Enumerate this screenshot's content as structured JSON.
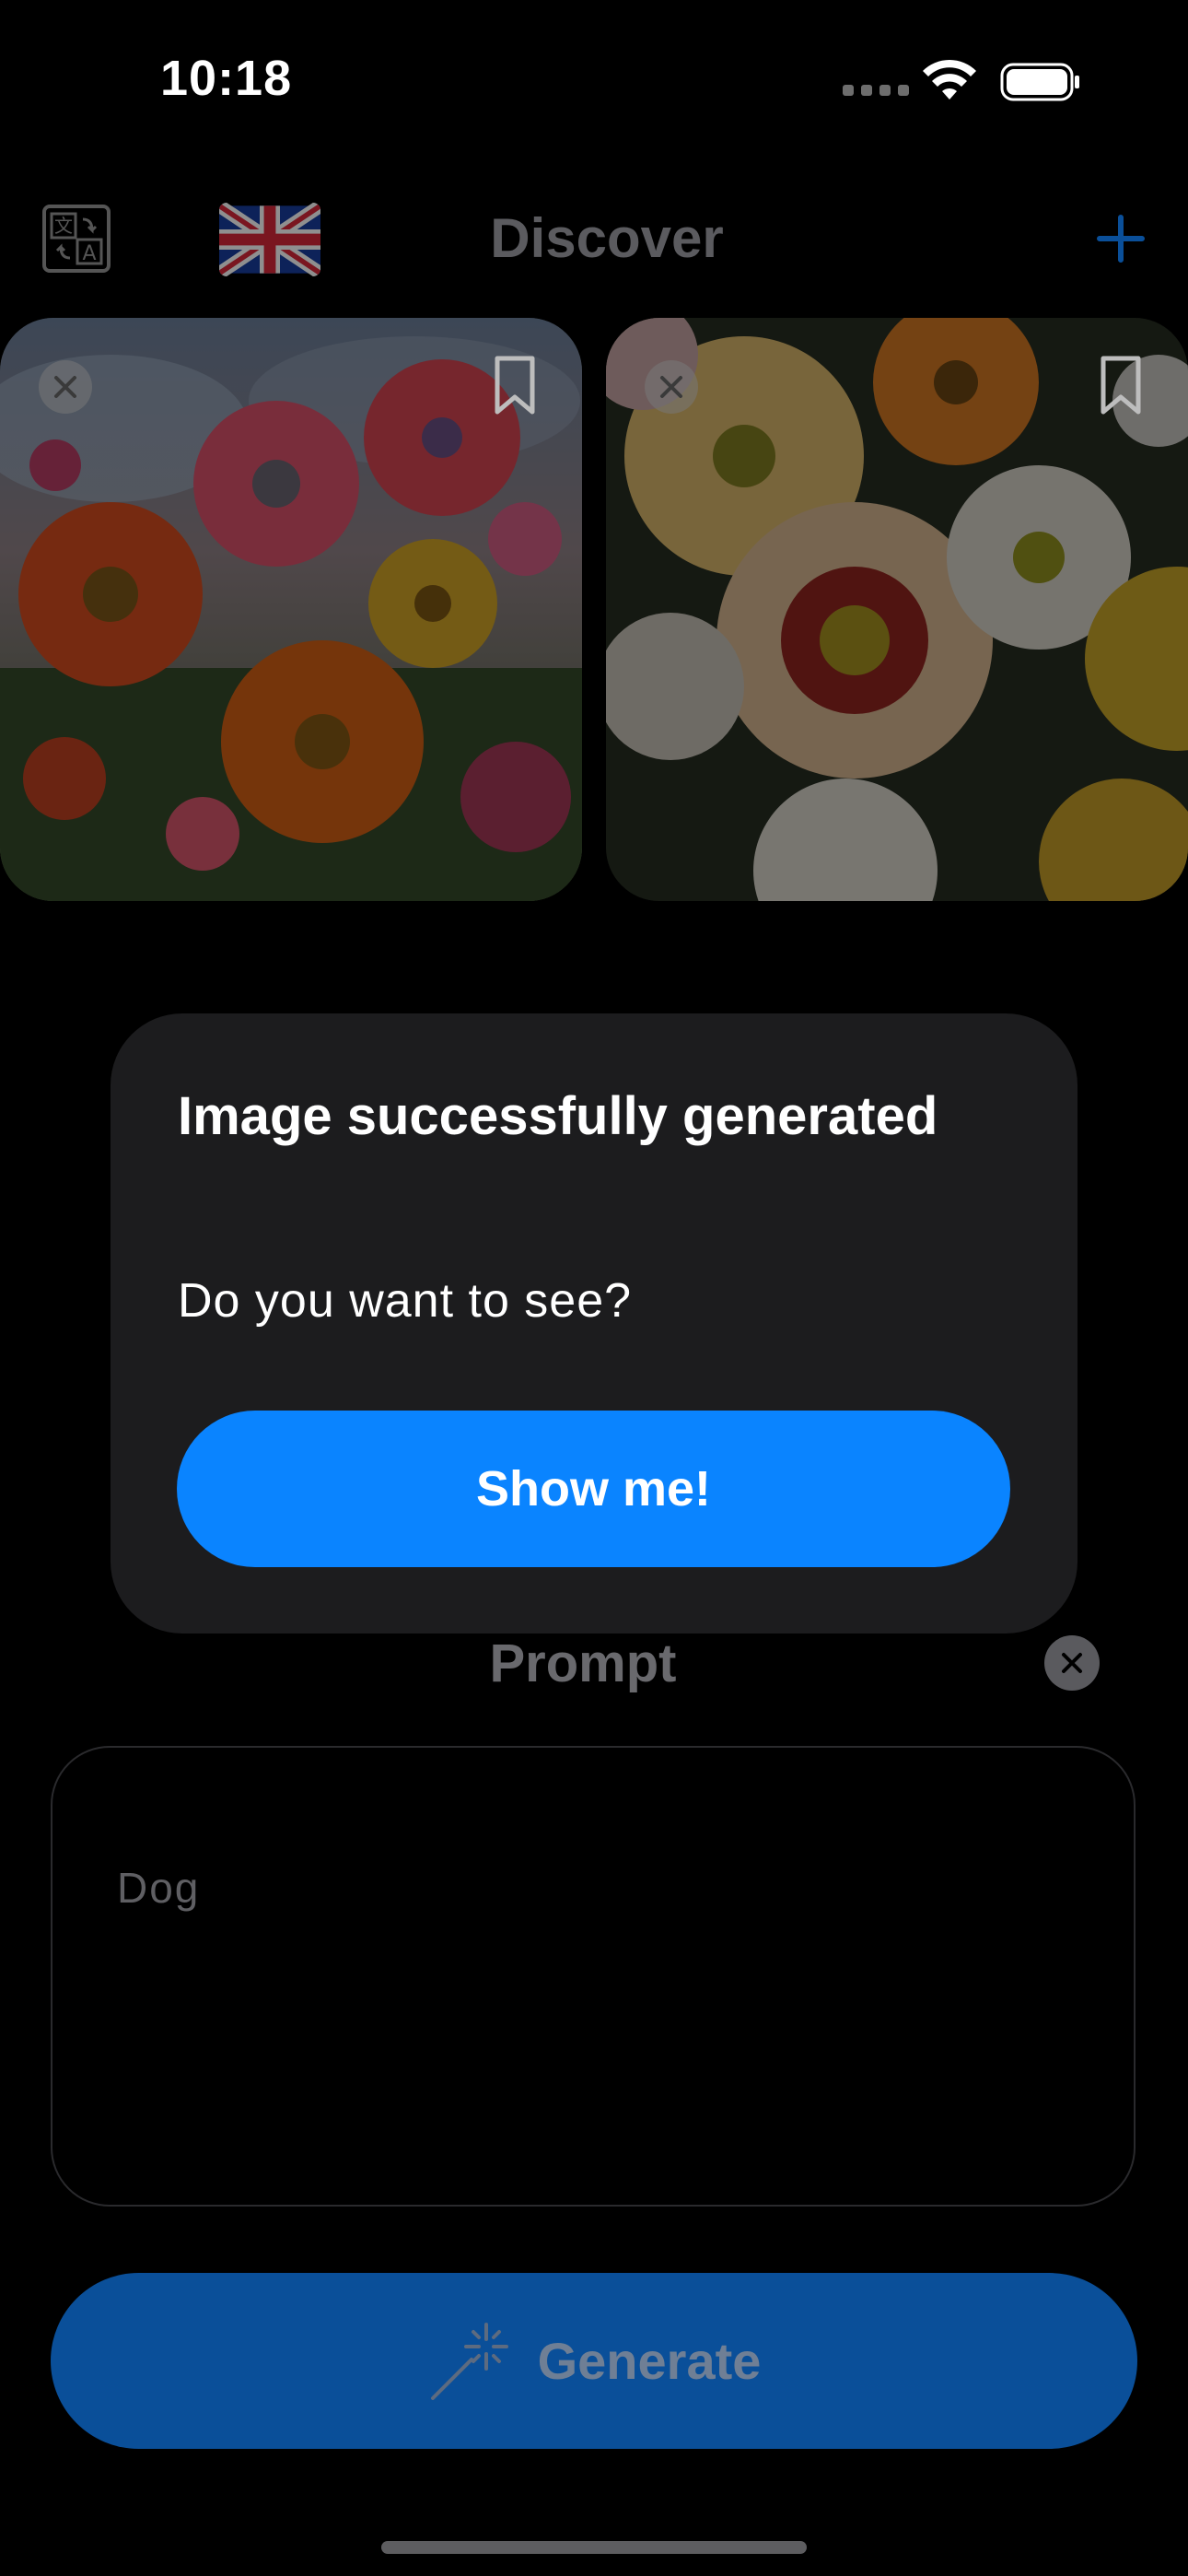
{
  "status_bar": {
    "time": "10:18"
  },
  "header": {
    "title": "Discover",
    "icons": [
      "translate-icon",
      "uk-flag-icon",
      "plus-icon"
    ]
  },
  "gallery": {
    "cards": [
      {
        "name": "flowers-painting-colorful"
      },
      {
        "name": "flowers-painting-white-yellow"
      }
    ]
  },
  "prompt": {
    "title": "Prompt",
    "value": "Dog"
  },
  "generate": {
    "label": "Generate"
  },
  "alert": {
    "title": "Image successfully generated",
    "message": "Do you want to see?",
    "button_label": "Show me!"
  },
  "colors": {
    "accent": "#0a84ff",
    "dialog_bg": "#1c1c1e",
    "background": "#000000"
  }
}
